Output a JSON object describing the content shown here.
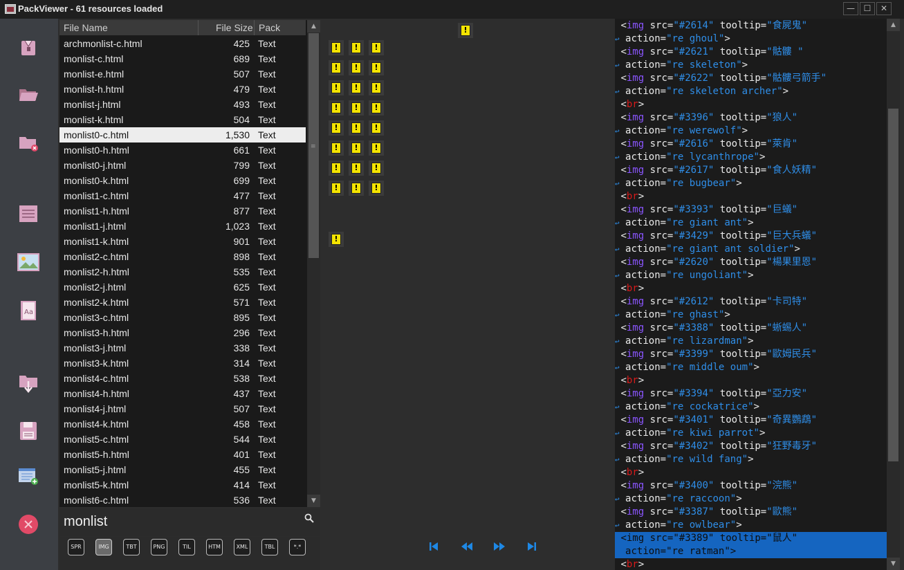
{
  "window": {
    "title": "PackViewer - 61 resources loaded",
    "controls": {
      "minimize": "—",
      "maximize": "☐",
      "close": "✕"
    }
  },
  "sidebar": {
    "buttons": [
      {
        "name": "open-pack-button",
        "icon": "package-icon"
      },
      {
        "name": "open-folder-button",
        "icon": "open-folder-icon"
      },
      {
        "name": "close-folder-button",
        "icon": "folder-remove-icon"
      },
      {
        "name": "text-view-button",
        "icon": "document-lines-icon"
      },
      {
        "name": "image-view-button",
        "icon": "image-icon"
      },
      {
        "name": "font-view-button",
        "icon": "font-book-icon"
      },
      {
        "name": "extract-button",
        "icon": "folder-download-icon"
      },
      {
        "name": "save-button",
        "icon": "floppy-disk-icon"
      },
      {
        "name": "add-note-button",
        "icon": "note-add-icon"
      },
      {
        "name": "exit-button",
        "icon": "close-circle-icon"
      }
    ]
  },
  "file_list": {
    "columns": {
      "name": "File Name",
      "size": "File Size",
      "pack": "Pack"
    },
    "scroll": {
      "up": "▲",
      "down": "▼",
      "grip": "≡"
    },
    "selected_index": 6,
    "rows": [
      {
        "name": "archmonlist-c.html",
        "size": "425",
        "pack": "Text"
      },
      {
        "name": "monlist-c.html",
        "size": "689",
        "pack": "Text"
      },
      {
        "name": "monlist-e.html",
        "size": "507",
        "pack": "Text"
      },
      {
        "name": "monlist-h.html",
        "size": "479",
        "pack": "Text"
      },
      {
        "name": "monlist-j.html",
        "size": "493",
        "pack": "Text"
      },
      {
        "name": "monlist-k.html",
        "size": "504",
        "pack": "Text"
      },
      {
        "name": "monlist0-c.html",
        "size": "1,530",
        "pack": "Text"
      },
      {
        "name": "monlist0-h.html",
        "size": "661",
        "pack": "Text"
      },
      {
        "name": "monlist0-j.html",
        "size": "799",
        "pack": "Text"
      },
      {
        "name": "monlist0-k.html",
        "size": "699",
        "pack": "Text"
      },
      {
        "name": "monlist1-c.html",
        "size": "477",
        "pack": "Text"
      },
      {
        "name": "monlist1-h.html",
        "size": "877",
        "pack": "Text"
      },
      {
        "name": "monlist1-j.html",
        "size": "1,023",
        "pack": "Text"
      },
      {
        "name": "monlist1-k.html",
        "size": "901",
        "pack": "Text"
      },
      {
        "name": "monlist2-c.html",
        "size": "898",
        "pack": "Text"
      },
      {
        "name": "monlist2-h.html",
        "size": "535",
        "pack": "Text"
      },
      {
        "name": "monlist2-j.html",
        "size": "625",
        "pack": "Text"
      },
      {
        "name": "monlist2-k.html",
        "size": "571",
        "pack": "Text"
      },
      {
        "name": "monlist3-c.html",
        "size": "895",
        "pack": "Text"
      },
      {
        "name": "monlist3-h.html",
        "size": "296",
        "pack": "Text"
      },
      {
        "name": "monlist3-j.html",
        "size": "338",
        "pack": "Text"
      },
      {
        "name": "monlist3-k.html",
        "size": "314",
        "pack": "Text"
      },
      {
        "name": "monlist4-c.html",
        "size": "538",
        "pack": "Text"
      },
      {
        "name": "monlist4-h.html",
        "size": "437",
        "pack": "Text"
      },
      {
        "name": "monlist4-j.html",
        "size": "507",
        "pack": "Text"
      },
      {
        "name": "monlist4-k.html",
        "size": "458",
        "pack": "Text"
      },
      {
        "name": "monlist5-c.html",
        "size": "544",
        "pack": "Text"
      },
      {
        "name": "monlist5-h.html",
        "size": "401",
        "pack": "Text"
      },
      {
        "name": "monlist5-j.html",
        "size": "455",
        "pack": "Text"
      },
      {
        "name": "monlist5-k.html",
        "size": "414",
        "pack": "Text"
      },
      {
        "name": "monlist6-c.html",
        "size": "536",
        "pack": "Text"
      }
    ]
  },
  "search": {
    "query": "monlist",
    "icon": "search-icon"
  },
  "filters": [
    {
      "label": "SPR",
      "active": false
    },
    {
      "label": "IMG",
      "active": true
    },
    {
      "label": "TBT",
      "active": false
    },
    {
      "label": "PNG",
      "active": false
    },
    {
      "label": "TIL",
      "active": false
    },
    {
      "label": "HTM",
      "active": false
    },
    {
      "label": "XML",
      "active": false
    },
    {
      "label": "TBL",
      "active": false
    },
    {
      "label": "*.*",
      "active": false
    }
  ],
  "preview": {
    "tile_glyph": "!",
    "tile_count": 26,
    "nav": [
      {
        "name": "first-page-button",
        "icon": "skip-first-icon"
      },
      {
        "name": "previous-page-button",
        "icon": "rewind-icon"
      },
      {
        "name": "next-page-button",
        "icon": "fast-forward-icon"
      },
      {
        "name": "last-page-button",
        "icon": "skip-last-icon"
      }
    ]
  },
  "code": {
    "wrap_mark": "↩",
    "lines": [
      {
        "kind": "img",
        "src": "#2614",
        "tooltip": "食屍鬼",
        "wrapped": false
      },
      {
        "kind": "action",
        "action": "re ghoul",
        "wrapped": true
      },
      {
        "kind": "img",
        "src": "#2621",
        "tooltip": "骷髏 ",
        "wrapped": false
      },
      {
        "kind": "action",
        "action": "re skeleton",
        "wrapped": true
      },
      {
        "kind": "img",
        "src": "#2622",
        "tooltip": "骷髏弓箭手",
        "wrapped": false
      },
      {
        "kind": "action",
        "action": "re skeleton archer",
        "wrapped": true
      },
      {
        "kind": "br"
      },
      {
        "kind": "img",
        "src": "#3396",
        "tooltip": "狼人",
        "wrapped": false
      },
      {
        "kind": "action",
        "action": "re werewolf",
        "wrapped": true
      },
      {
        "kind": "img",
        "src": "#2616",
        "tooltip": "萊肯",
        "wrapped": false
      },
      {
        "kind": "action",
        "action": "re lycanthrope",
        "wrapped": true
      },
      {
        "kind": "img",
        "src": "#2617",
        "tooltip": "食人妖精",
        "wrapped": false
      },
      {
        "kind": "action",
        "action": "re bugbear",
        "wrapped": true
      },
      {
        "kind": "br"
      },
      {
        "kind": "img",
        "src": "#3393",
        "tooltip": "巨蟻",
        "wrapped": false
      },
      {
        "kind": "action",
        "action": "re giant ant",
        "wrapped": true
      },
      {
        "kind": "img",
        "src": "#3429",
        "tooltip": "巨大兵蟻",
        "wrapped": false
      },
      {
        "kind": "action",
        "action": "re giant ant soldier",
        "wrapped": true
      },
      {
        "kind": "img",
        "src": "#2620",
        "tooltip": "楊果里恩",
        "wrapped": false
      },
      {
        "kind": "action",
        "action": "re ungoliant",
        "wrapped": true
      },
      {
        "kind": "br"
      },
      {
        "kind": "img",
        "src": "#2612",
        "tooltip": "卡司特",
        "wrapped": false
      },
      {
        "kind": "action",
        "action": "re ghast",
        "wrapped": true
      },
      {
        "kind": "img",
        "src": "#3388",
        "tooltip": "蜥蜴人",
        "wrapped": false
      },
      {
        "kind": "action",
        "action": "re lizardman",
        "wrapped": true
      },
      {
        "kind": "img",
        "src": "#3399",
        "tooltip": "歐姆民兵",
        "wrapped": false
      },
      {
        "kind": "action",
        "action": "re middle oum",
        "wrapped": true
      },
      {
        "kind": "br"
      },
      {
        "kind": "img",
        "src": "#3394",
        "tooltip": "亞力安",
        "wrapped": false
      },
      {
        "kind": "action",
        "action": "re cockatrice",
        "wrapped": true
      },
      {
        "kind": "img",
        "src": "#3401",
        "tooltip": "奇異鸚鵡",
        "wrapped": false
      },
      {
        "kind": "action",
        "action": "re kiwi parrot",
        "wrapped": true
      },
      {
        "kind": "img",
        "src": "#3402",
        "tooltip": "狂野毒牙",
        "wrapped": false
      },
      {
        "kind": "action",
        "action": "re wild fang",
        "wrapped": true
      },
      {
        "kind": "br"
      },
      {
        "kind": "img",
        "src": "#3400",
        "tooltip": "浣熊",
        "wrapped": false
      },
      {
        "kind": "action",
        "action": "re raccoon",
        "wrapped": true
      },
      {
        "kind": "img",
        "src": "#3387",
        "tooltip": "歐熊",
        "wrapped": false
      },
      {
        "kind": "action",
        "action": "re owlbear",
        "wrapped": true
      },
      {
        "kind": "img",
        "src": "#3389",
        "tooltip": "鼠人",
        "wrapped": false,
        "selected": true
      },
      {
        "kind": "action",
        "action": "re ratman",
        "wrapped": false,
        "selected": true
      },
      {
        "kind": "br"
      }
    ]
  },
  "colors": {
    "tag": "#8a55ff",
    "value": "#2f8ee8",
    "br": "#d81b1b",
    "selection": "#1565c0",
    "tile_icon": "#f4e400",
    "sidebar_icon": "#d7a3c0",
    "nav_icon": "#1e88e5"
  }
}
